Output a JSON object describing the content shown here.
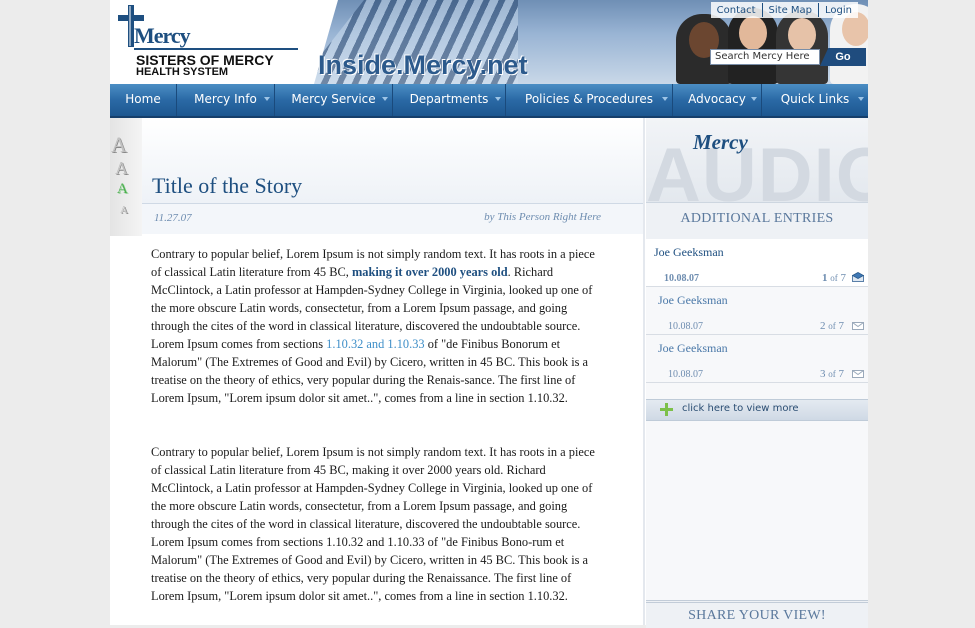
{
  "header": {
    "logo_word": "Mercy",
    "logo_line1": "SISTERS OF MERCY",
    "logo_line2": "HEALTH SYSTEM",
    "site_title": "Inside.Mercy.net",
    "util_links": [
      "Contact",
      "Site Map",
      "Login"
    ],
    "search": {
      "placeholder": "Search Mercy Here",
      "button": "Go"
    }
  },
  "nav": {
    "items": [
      {
        "label": "Home",
        "dropdown": false
      },
      {
        "label": "Mercy Info",
        "dropdown": true
      },
      {
        "label": "Mercy Service",
        "dropdown": true
      },
      {
        "label": "Departments",
        "dropdown": true
      },
      {
        "label": "Policies & Procedures",
        "dropdown": true
      },
      {
        "label": "Advocacy",
        "dropdown": true
      },
      {
        "label": "Quick Links",
        "dropdown": true
      }
    ]
  },
  "font_sizer": {
    "letters": [
      "A",
      "A",
      "A",
      "A"
    ],
    "active_index": 2
  },
  "article": {
    "title": "Title of the Story",
    "date": "11.27.07",
    "byline": "by This Person Right Here",
    "p1": {
      "t1": "Contrary to popular belief, Lorem Ipsum is not simply random text. It has roots in a piece of classical Latin literature from 45 BC, ",
      "link1": "making it over 2000 years old",
      "t2": ". Richard McClintock, a Latin professor at Hampden-Sydney College in Virginia, looked up one of the more obscure Latin words, consectetur, from a Lorem Ipsum passage, and going through the cites of the word in classical literature, discovered the undoubtable source. Lorem Ipsum comes from sections ",
      "link2": "1.10.32 and 1.10.33",
      "t3": " of \"de Finibus Bonorum et Malorum\" (The Extremes of Good and Evil) by Cicero, written in 45 BC. This book is a treatise on the theory of ethics, very popular during the Renais-sance. The first line of Lorem Ipsum, \"Lorem ipsum dolor sit amet..\", comes from a line in section 1.10.32."
    },
    "p2": "Contrary to popular belief, Lorem Ipsum is not simply random text. It has roots in a piece of classical Latin literature from 45 BC, making it over 2000 years old. Richard McClintock, a Latin professor at Hampden-Sydney College in Virginia, looked up one of the more obscure Latin words, consectetur, from a Lorem Ipsum passage, and going through the cites of the word in classical literature, discovered the undoubtable source. Lorem Ipsum comes from sections 1.10.32 and 1.10.33 of \"de Finibus Bono-rum et Malorum\" (The Extremes of Good and Evil) by Cicero, written in 45 BC. This book is a treatise on the theory of ethics, very popular during the Renaissance. The first line of Lorem Ipsum, \"Lorem ipsum dolor sit amet..\", comes from a line in section 1.10.32."
  },
  "sidebar": {
    "audio_mercy": "Mercy",
    "audio_word": "AUDIO",
    "additional_title": "ADDITIONAL ENTRIES",
    "entries": [
      {
        "name": "Joe Geeksman",
        "date": "10.08.07",
        "num": "1",
        "of": "of",
        "total": "7",
        "active": true
      },
      {
        "name": "Joe Geeksman",
        "date": "10.08.07",
        "num": "2",
        "of": "of",
        "total": "7",
        "active": false
      },
      {
        "name": "Joe Geeksman",
        "date": "10.08.07",
        "num": "3",
        "of": "of",
        "total": "7",
        "active": false
      }
    ],
    "view_more": "click here to view more",
    "share_title": "SHARE YOUR VIEW!"
  },
  "colors": {
    "brand_blue": "#1e4f80",
    "link_blue": "#3f8fc8",
    "nav_blue": "#2a69a5",
    "meta_blue": "#6e8db0"
  },
  "icons": [
    "mercy-cross-icon",
    "chevron-down-icon",
    "plus-icon",
    "open-envelope-icon",
    "envelope-icon"
  ]
}
